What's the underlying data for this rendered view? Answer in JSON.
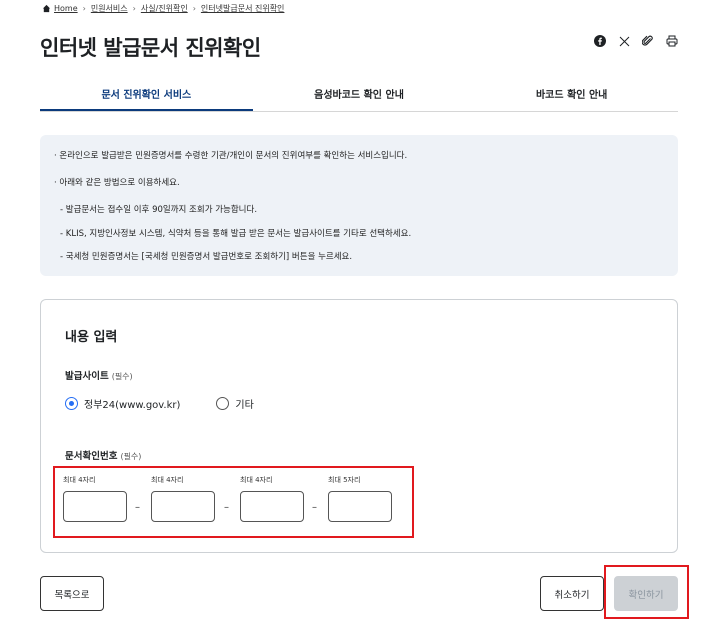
{
  "breadcrumb": {
    "items": [
      "Home",
      "민원서비스",
      "사실/진위확인",
      "인터넷발급문서 진위확인"
    ]
  },
  "page": {
    "title": "인터넷 발급문서 진위확인"
  },
  "share": {
    "icons": [
      "facebook-icon",
      "x-icon",
      "link-icon",
      "print-icon"
    ]
  },
  "tabs": [
    {
      "label": "문서 진위확인 서비스",
      "active": true
    },
    {
      "label": "음성바코드 확인 안내",
      "active": false
    },
    {
      "label": "바코드 확인 안내",
      "active": false
    }
  ],
  "info": {
    "line1": "· 온라인으로 발급받은 민원증명서를 수령한 기관/개인이 문서의 진위여부를 확인하는 서비스입니다.",
    "line2": "· 아래와 같은 방법으로 이용하세요.",
    "sub1": "- 발급문서는 접수일 이후 90일까지 조회가 가능합니다.",
    "sub2": "- KLIS, 지방인사정보 시스템, 식약처 등을 통해 발급 받은 문서는 발급사이트를 기타로 선택하세요.",
    "sub3": "- 국세청 민원증명서는 [국세청 민원증명서 발급번호로 조회하기] 버튼을 누르세요."
  },
  "form": {
    "title": "내용 입력",
    "site_label": "발급사이트",
    "required": "(필수)",
    "options": [
      {
        "label": "정부24(www.gov.kr)",
        "checked": true
      },
      {
        "label": "기타",
        "checked": false
      }
    ],
    "doc_label": "문서확인번호",
    "fields": [
      {
        "hint": "최대 4자리",
        "value": ""
      },
      {
        "hint": "최대 4자리",
        "value": ""
      },
      {
        "hint": "최대 4자리",
        "value": ""
      },
      {
        "hint": "최대 5자리",
        "value": ""
      }
    ],
    "dash": "–"
  },
  "buttons": {
    "back": "목록으로",
    "cancel": "취소하기",
    "confirm": "확인하기"
  },
  "colors": {
    "primary": "#0b3a7c",
    "radio": "#256ef4",
    "highlight": "#e1191e",
    "info_bg": "#eef2f7"
  }
}
